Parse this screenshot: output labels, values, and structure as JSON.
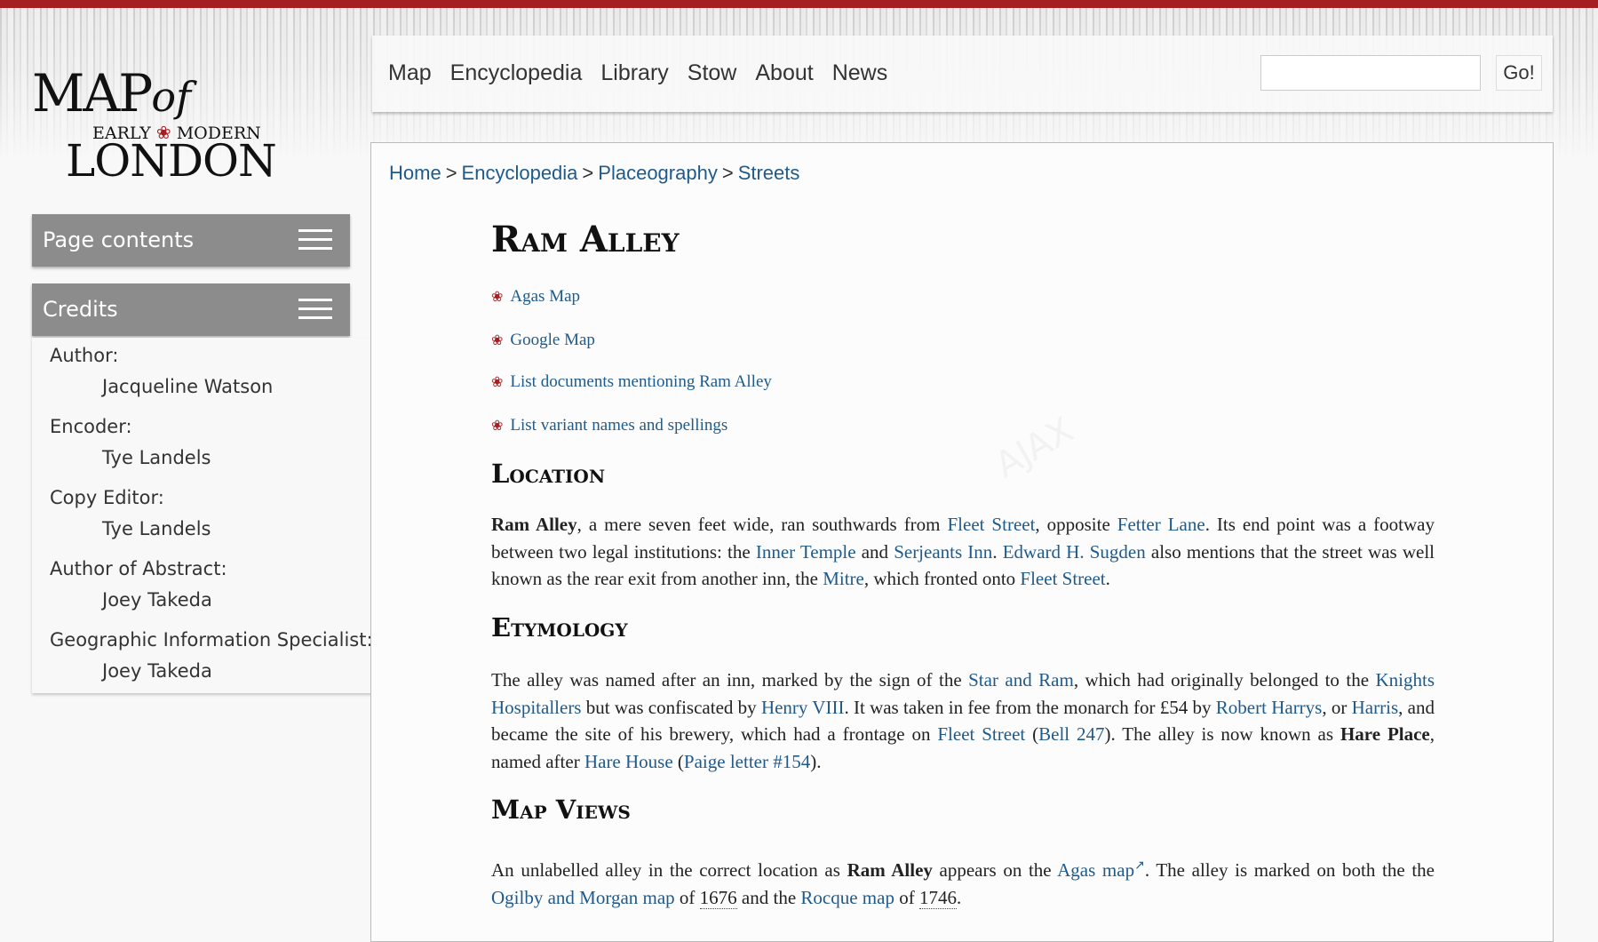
{
  "logo": {
    "line1": "MAP",
    "of": "of",
    "line2_left": "EARLY",
    "line2_right": "MODERN",
    "line3": "LONDON",
    "rose": "❀"
  },
  "nav": {
    "items": [
      "Map",
      "Encyclopedia",
      "Library",
      "Stow",
      "About",
      "News"
    ],
    "search_placeholder": "",
    "go": "Go!"
  },
  "sidebar": {
    "page_contents": "Page contents",
    "credits": "Credits",
    "credits_list": [
      {
        "role": "Author:",
        "name": "Jacqueline Watson"
      },
      {
        "role": "Encoder:",
        "name": "Tye Landels"
      },
      {
        "role": "Copy Editor:",
        "name": "Tye Landels"
      },
      {
        "role": "Author of Abstract:",
        "name": "Joey Takeda"
      },
      {
        "role": "Geographic Information Specialist:",
        "name": "Joey Takeda"
      }
    ]
  },
  "breadcrumb": [
    "Home",
    "Encyclopedia",
    "Placeography",
    "Streets"
  ],
  "title": "Ram Alley",
  "quick_links": [
    "Agas Map",
    "Google Map",
    "List documents mentioning Ram Alley",
    "List variant names and spellings"
  ],
  "sections": {
    "location": {
      "heading": "Location",
      "parts": [
        {
          "t": "Ram Alley",
          "b": true
        },
        {
          "t": ", a mere seven feet wide, ran southwards from "
        },
        {
          "t": "Fleet Street",
          "link": true
        },
        {
          "t": ", opposite "
        },
        {
          "t": "Fetter Lane",
          "link": true
        },
        {
          "t": ". Its end point was a footway between two legal institutions: the "
        },
        {
          "t": "Inner Temple",
          "link": true
        },
        {
          "t": " and "
        },
        {
          "t": "Serjeants Inn",
          "link": true
        },
        {
          "t": ". "
        },
        {
          "t": "Edward H. Sugden",
          "link": true
        },
        {
          "t": " also mentions that the street was well known as the rear exit from another inn, the "
        },
        {
          "t": "Mitre",
          "link": true
        },
        {
          "t": ", which fronted onto "
        },
        {
          "t": "Fleet Street",
          "link": true
        },
        {
          "t": "."
        }
      ]
    },
    "etymology": {
      "heading": "Etymology",
      "parts": [
        {
          "t": "The alley was named after an inn, marked by the sign of the "
        },
        {
          "t": "Star and Ram",
          "link": true
        },
        {
          "t": ", which had originally belonged to the "
        },
        {
          "t": "Knights Hospitallers",
          "link": true
        },
        {
          "t": " but was confiscated by "
        },
        {
          "t": "Henry VIII",
          "link": true
        },
        {
          "t": ". It was taken in fee from the monarch for £54 by "
        },
        {
          "t": "Robert Harrys",
          "link": true
        },
        {
          "t": ", or "
        },
        {
          "t": "Harris",
          "link": true
        },
        {
          "t": ", and became the site of his brewery, which had a frontage on "
        },
        {
          "t": "Fleet Street",
          "link": true
        },
        {
          "t": " ("
        },
        {
          "t": "Bell 247",
          "link": true
        },
        {
          "t": "). The alley is now known as "
        },
        {
          "t": "Hare Place",
          "b": true
        },
        {
          "t": ", named after "
        },
        {
          "t": "Hare House",
          "link": true
        },
        {
          "t": " ("
        },
        {
          "t": "Paige letter #154",
          "link": true
        },
        {
          "t": ")."
        }
      ]
    },
    "map_views": {
      "heading": "Map Views",
      "parts": [
        {
          "t": "An unlabelled alley in the correct location as "
        },
        {
          "t": "Ram Alley",
          "b": true
        },
        {
          "t": " appears on the "
        },
        {
          "t": "Agas map",
          "link": true,
          "ext": true
        },
        {
          "t": ". The alley is marked on both the the "
        },
        {
          "t": "Ogilby and Morgan map",
          "link": true
        },
        {
          "t": " of "
        },
        {
          "t": "1676",
          "dotted": true
        },
        {
          "t": " and the "
        },
        {
          "t": "Rocque map",
          "link": true
        },
        {
          "t": " of "
        },
        {
          "t": "1746",
          "dotted": true
        },
        {
          "t": "."
        }
      ]
    }
  },
  "watermark": "AJAX"
}
